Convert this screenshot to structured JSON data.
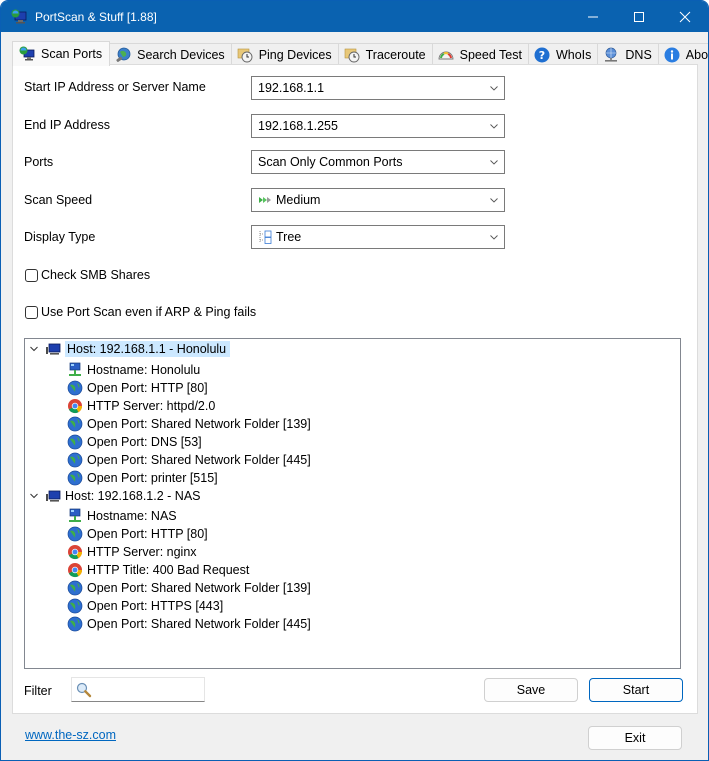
{
  "window": {
    "title": "PortScan & Stuff [1.88]",
    "controls": {
      "minimize": "—",
      "maximize": "☐",
      "close": "✕"
    }
  },
  "tabs": [
    {
      "label": "Scan Ports",
      "icon": "network-computer-icon",
      "active": true
    },
    {
      "label": "Search Devices",
      "icon": "magnifier-globe-icon",
      "active": false
    },
    {
      "label": "Ping Devices",
      "icon": "clock-folder-icon",
      "active": false
    },
    {
      "label": "Traceroute",
      "icon": "clock-folder-icon",
      "active": false
    },
    {
      "label": "Speed Test",
      "icon": "speedometer-icon",
      "active": false
    },
    {
      "label": "WhoIs",
      "icon": "question-icon",
      "active": false
    },
    {
      "label": "DNS",
      "icon": "network-globe-icon",
      "active": false
    },
    {
      "label": "About",
      "icon": "info-icon",
      "active": false
    }
  ],
  "form": {
    "start_ip": {
      "label": "Start IP Address or Server Name",
      "value": "192.168.1.1"
    },
    "end_ip": {
      "label": "End IP Address",
      "value": "192.168.1.255"
    },
    "ports": {
      "label": "Ports",
      "value": "Scan Only Common Ports"
    },
    "scan_speed": {
      "label": "Scan Speed",
      "value": "Medium",
      "icon": "fast-forward-icon"
    },
    "display_type": {
      "label": "Display Type",
      "value": "Tree",
      "icon": "tree-view-icon"
    },
    "check_smb": {
      "label": "Check SMB Shares",
      "checked": false
    },
    "force_port_scan": {
      "label": "Use Port Scan even if ARP & Ping fails",
      "checked": false
    }
  },
  "results": {
    "hosts": [
      {
        "label": "Host: 192.168.1.1 - Honolulu",
        "expanded": true,
        "selected": true,
        "children": [
          {
            "label": "Hostname: Honolulu",
            "icon": "hostname-icon"
          },
          {
            "label": "Open Port: HTTP [80]",
            "icon": "globe-icon"
          },
          {
            "label": "HTTP Server: httpd/2.0",
            "icon": "browser-icon"
          },
          {
            "label": "Open Port: Shared Network Folder [139]",
            "icon": "globe-icon"
          },
          {
            "label": "Open Port: DNS [53]",
            "icon": "globe-icon"
          },
          {
            "label": "Open Port: Shared Network Folder [445]",
            "icon": "globe-icon"
          },
          {
            "label": "Open Port: printer [515]",
            "icon": "globe-icon"
          }
        ]
      },
      {
        "label": "Host: 192.168.1.2 - NAS",
        "expanded": true,
        "selected": false,
        "children": [
          {
            "label": "Hostname: NAS",
            "icon": "hostname-icon"
          },
          {
            "label": "Open Port: HTTP [80]",
            "icon": "globe-icon"
          },
          {
            "label": "HTTP Server: nginx",
            "icon": "browser-icon"
          },
          {
            "label": "HTTP Title: 400 Bad Request",
            "icon": "browser-icon"
          },
          {
            "label": "Open Port: Shared Network Folder [139]",
            "icon": "globe-icon"
          },
          {
            "label": "Open Port: HTTPS [443]",
            "icon": "globe-icon"
          },
          {
            "label": "Open Port: Shared Network Folder [445]",
            "icon": "globe-icon"
          }
        ]
      }
    ]
  },
  "footer": {
    "filter_label": "Filter",
    "filter_value": "",
    "save_label": "Save",
    "start_label": "Start",
    "website_link": "www.the-sz.com",
    "exit_label": "Exit"
  },
  "colors": {
    "titlebar": "#0a62b0",
    "selection": "#cce8ff",
    "link": "#0067c0",
    "primary_button_border": "#0067c0"
  }
}
